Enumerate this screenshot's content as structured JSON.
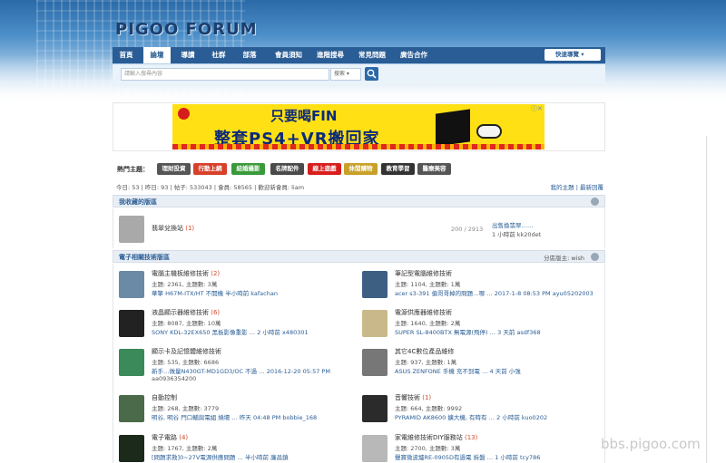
{
  "logo_text": "PIGOO FORUM",
  "nav": {
    "items": [
      "首頁",
      "論壇",
      "導讀",
      "社群",
      "部落",
      "會員須知",
      "進階搜尋",
      "常見問題",
      "廣告合作"
    ],
    "active_index": 1,
    "quick_nav": "快速導覽"
  },
  "search": {
    "placeholder": "請輸入搜尋內容",
    "scope": "搜索",
    "button_icon": "search-icon"
  },
  "ad": {
    "line1": "只要喝FIN",
    "line2": "整套PS4+VR搬回家",
    "close_label": "ⓘ✕"
  },
  "hot_topics": {
    "label": "熱門主題：",
    "tags": [
      {
        "text": "理財投資",
        "color": "#555555"
      },
      {
        "text": "行動上網",
        "color": "#d8402a"
      },
      {
        "text": "結婚攝影",
        "color": "#3a9a3a"
      },
      {
        "text": "名牌配件",
        "color": "#4a4a4a"
      },
      {
        "text": "線上遊戲",
        "color": "#d81e1e"
      },
      {
        "text": "休閒購物",
        "color": "#c8a02a"
      },
      {
        "text": "教育學習",
        "color": "#333333"
      },
      {
        "text": "醫療美容",
        "color": "#555555"
      }
    ]
  },
  "stats": {
    "left": "今日: 53 | 昨日: 93 | 帖子: 533043 | 會員: 58565 | 歡迎新會員: liam",
    "my_topics": "我的主題",
    "latest_replies": "最新回覆"
  },
  "sections": [
    {
      "title": "我收藏的版區",
      "right": "",
      "forums": [
        {
          "name": "翡翠兌換站",
          "count": "(1)",
          "meta": "",
          "last": "",
          "last2": "",
          "icon": "calculator-icon",
          "side_count": "200 / 2913",
          "side_title": "出售換翡翠……",
          "side_time": "1 小時前  kk20det"
        }
      ]
    },
    {
      "title": "電子相關技術版區",
      "right": "分區版主: wish",
      "forums": [
        {
          "name": "電腦主機板維修技術",
          "count": "(2)",
          "meta": "主題: 2361, 主題數: 3萬",
          "last": "華擎 H67M-ITX/HT 不開機 半小時前 kafachan",
          "icon": "motherboard-icon"
        },
        {
          "name": "筆記型電腦維修技術",
          "count": "",
          "meta": "主題: 1104, 主題數: 1萬",
          "last": "acer s3-391 偏哥哥掉的問題…哪 … 2017-1-8 08:53 PM ayu05202003",
          "icon": "laptop-icon"
        },
        {
          "name": "液晶顯示器維修技術",
          "count": "(6)",
          "meta": "主題: 8087, 主題數: 10萬",
          "last": "SONY KDL-32EX650 黑板影像重影 … 2 小時前 x480301",
          "icon": "monitor-icon"
        },
        {
          "name": "電源供應器維修技術",
          "count": "",
          "meta": "主題: 1640, 主題數: 2萬",
          "last": "SUPER SL-8400BTX 無電源(飛停) … 3 天前 asdf368",
          "icon": "psu-icon"
        },
        {
          "name": "顯示卡及記憶體維修技術",
          "count": "",
          "meta": "主題: 535, 主題數: 6686",
          "last": "新手…做量N430GT-MD1GD3/OC 不過 … 2016-12-20 05:57 PM",
          "last2": "aa0936354200",
          "icon": "graphics-card-icon"
        },
        {
          "name": "其它4C數位產品維修",
          "count": "",
          "meta": "主題: 937, 主題數: 1萬",
          "last": "ASUS ZENFONE 手機 充不到電 … 4 天前 小強",
          "icon": "printer-icon"
        },
        {
          "name": "自動控制",
          "count": "",
          "meta": "主題: 268, 主題數: 3779",
          "last": "明谷, 明谷 門口輔與電組 燒壞 … 昨天 04:48 PM bobbie_168",
          "icon": "controller-icon"
        },
        {
          "name": "音響技術",
          "count": "(1)",
          "meta": "主題: 664, 主題數: 9992",
          "last": "PYRAMID AK8600 擴大機, 有時有 … 2 小時前 kuo0202",
          "icon": "speaker-icon"
        },
        {
          "name": "電子電路",
          "count": "(4)",
          "meta": "主題: 1767, 主題數: 2萬",
          "last": "[問題求救]0~27V電源供應問題 … 半小時前 廉昌鎮",
          "icon": "oscilloscope-icon"
        },
        {
          "name": "家電維修技術DIY服務站",
          "count": "(13)",
          "meta": "主題: 2700, 主題數: 3萬",
          "last": "聲寶微波爐RE-0905D有過電 拆盤 … 1 小時前 tcy786",
          "icon": "appliance-icon"
        }
      ]
    }
  ],
  "watermark": "bbs.pigoo.com"
}
